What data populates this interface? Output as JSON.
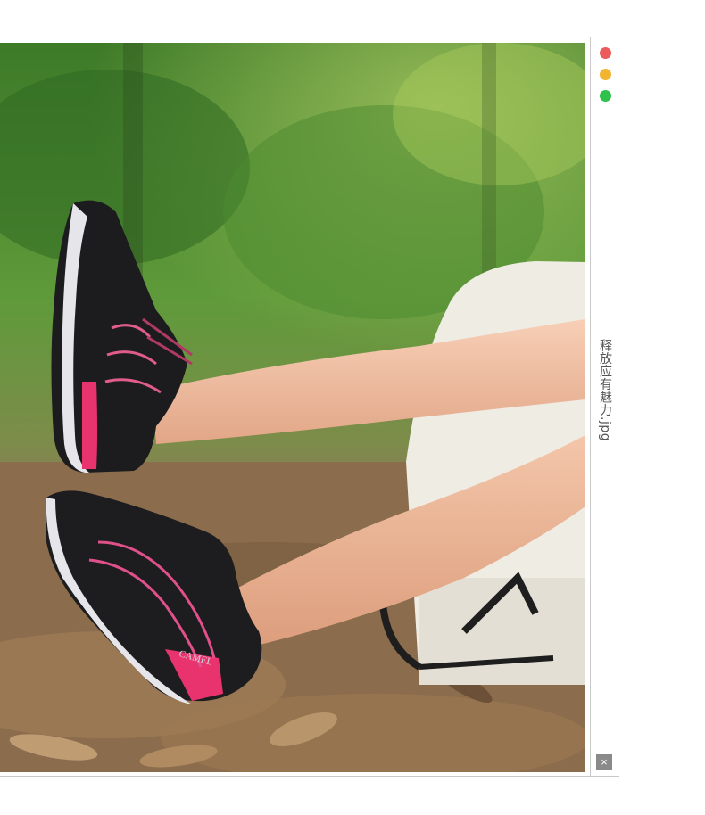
{
  "viewer": {
    "filename": "释放应有魅力.jpg",
    "close_symbol": "×",
    "controls": [
      {
        "name": "close-window",
        "color": "#ec5a5a"
      },
      {
        "name": "minimize-window",
        "color": "#f2b531"
      },
      {
        "name": "maximize-window",
        "color": "#2fc24b"
      }
    ]
  },
  "photo": {
    "brand_text": "CAMEL"
  }
}
